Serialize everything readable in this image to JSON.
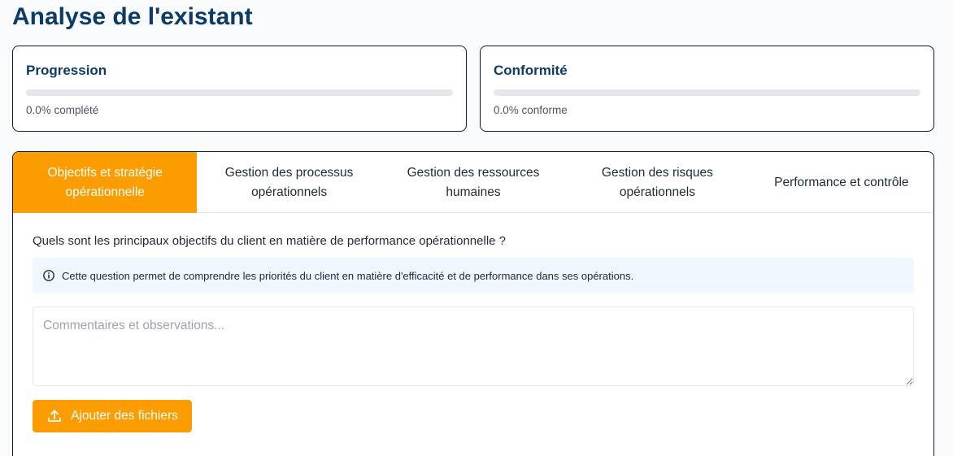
{
  "page": {
    "title": "Analyse de l'existant"
  },
  "cards": {
    "progress": {
      "title": "Progression",
      "value_percent": 0.0,
      "label": "0.0% complété"
    },
    "conformity": {
      "title": "Conformité",
      "value_percent": 0.0,
      "label": "0.0% conforme"
    }
  },
  "tabs": [
    {
      "label": "Objectifs et stratégie opérationnelle",
      "active": true
    },
    {
      "label": "Gestion des processus opérationnels",
      "active": false
    },
    {
      "label": "Gestion des ressources humaines",
      "active": false
    },
    {
      "label": "Gestion des risques opérationnels",
      "active": false
    },
    {
      "label": "Performance et contrôle",
      "active": false
    }
  ],
  "question": {
    "text": "Quels sont les principaux objectifs du client en matière de performance opérationnelle ?",
    "info": "Cette question permet de comprendre les priorités du client en matière d'efficacité et de performance dans ses opérations.",
    "comment_placeholder": "Commentaires et observations...",
    "comment_value": "",
    "upload_label": "Ajouter des fichiers"
  },
  "colors": {
    "accent": "#fb9d00",
    "title": "#0b3b66",
    "info_bg": "#eff6ff",
    "track": "#e5e7eb"
  },
  "icons": {
    "info": "info-icon",
    "upload": "upload-icon"
  }
}
